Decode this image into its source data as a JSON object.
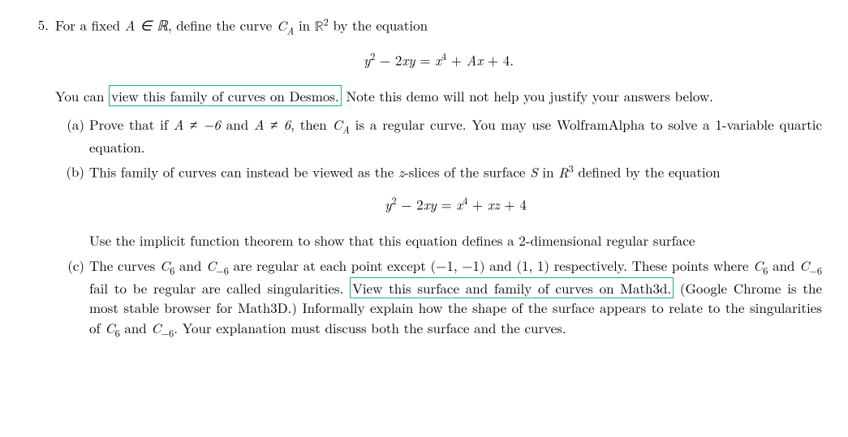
{
  "problem": {
    "number": "5.",
    "intro_prefix": "For a fixed ",
    "intro_A_in_R": "A ∈ ℝ",
    "intro_mid": ", define the curve ",
    "intro_CA": "C",
    "intro_CA_sub": "A",
    "intro_mid2": " in ",
    "intro_R2": "ℝ",
    "intro_R2_sup": "2",
    "intro_end": " by the equation",
    "eq1_lhs_y": "y",
    "eq1_lhs_sup2": "2",
    "eq1_minus": " − 2",
    "eq1_xy": "xy",
    "eq1_eq": " = ",
    "eq1_x": "x",
    "eq1_sup4": "4",
    "eq1_plus": " + ",
    "eq1_Ax": "Ax",
    "eq1_plus4": " + 4.",
    "note_prefix": "You can ",
    "note_linktext": "view this family of curves on Desmos.",
    "note_suffix": " Note this demo will not help you justify your answers below."
  },
  "parts": {
    "a": {
      "label": "(a)",
      "t1": "Prove that if ",
      "cond1": "A ≠ −6",
      "t2": " and ",
      "cond2": "A ≠ 6",
      "t3": ", then ",
      "CA": "C",
      "CA_sub": "A",
      "t4": " is a regular curve. You may use WolframAlpha to solve a 1-variable quartic equation."
    },
    "b": {
      "label": "(b)",
      "t1": "This family of curves can instead be viewed as the ",
      "z": "z",
      "t2": "-slices of the surface ",
      "S": "S",
      "t3": " in ",
      "R": "R",
      "R_sup": "3",
      "t4": " defined by the equation",
      "eq_y": "y",
      "eq_sup2": "2",
      "eq_minus": " − 2",
      "eq_xy": "xy",
      "eq_eq": " = ",
      "eq_x": "x",
      "eq_sup4": "4",
      "eq_plus": " + ",
      "eq_xz": "xz",
      "eq_plus4": " + 4",
      "t5": "Use the implicit function theorem to show that this equation defines a 2-dimensional regular surface"
    },
    "c": {
      "label": "(c)",
      "t1": "The curves ",
      "C6": "C",
      "C6_sub": "6",
      "t2": " and ",
      "Cm6": "C",
      "Cm6_sub": "−6",
      "t3": " are regular at each point except ",
      "pt1": "(−1, −1)",
      "t4": " and ",
      "pt2": "(1, 1)",
      "t5": " respectively. These points where ",
      "C6b": "C",
      "C6b_sub": "6",
      "t6": " and ",
      "Cm6b": "C",
      "Cm6b_sub": "−6",
      "t7": " fail to be regular are called singularities. ",
      "linktext": "View this surface and family of curves on Math3d.",
      "t8": " (Google Chrome is the most stable browser for Math3D.) Informally explain how the shape of the surface appears to relate to the singularities of ",
      "C6c": "C",
      "C6c_sub": "6",
      "t9": " and ",
      "Cm6c": "C",
      "Cm6c_sub": "−6",
      "t10": ". Your explanation must discuss both the surface and the curves."
    }
  }
}
